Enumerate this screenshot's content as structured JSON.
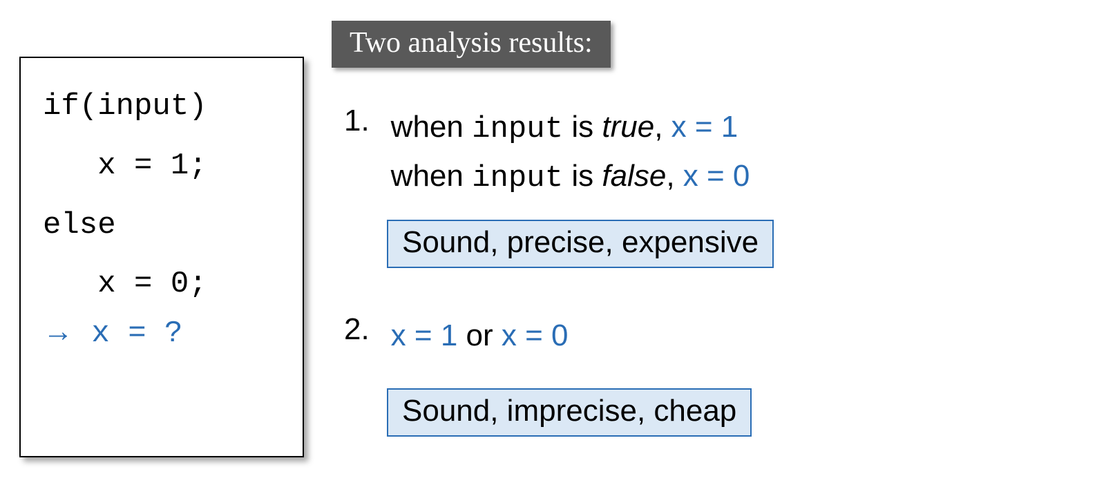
{
  "code": {
    "line1": "if(input)",
    "line2": "   x = 1;",
    "line3": "else",
    "line4": "   x = 0;",
    "arrow": "→",
    "question": " x = ?"
  },
  "header": "Two analysis results:",
  "item1": {
    "num": "1.",
    "l1_a": "when ",
    "l1_b": "input",
    "l1_c": " is ",
    "l1_d": "true",
    "l1_e": ",  ",
    "l1_f": "x = 1",
    "l2_a": "when ",
    "l2_b": "input",
    "l2_c": " is ",
    "l2_d": "false",
    "l2_e": ", ",
    "l2_f": "x = 0",
    "tag": "Sound, precise, expensive"
  },
  "item2": {
    "num": "2.",
    "a": "x = 1",
    "b": " or ",
    "c": "x = 0",
    "tag": "Sound, imprecise, cheap"
  }
}
